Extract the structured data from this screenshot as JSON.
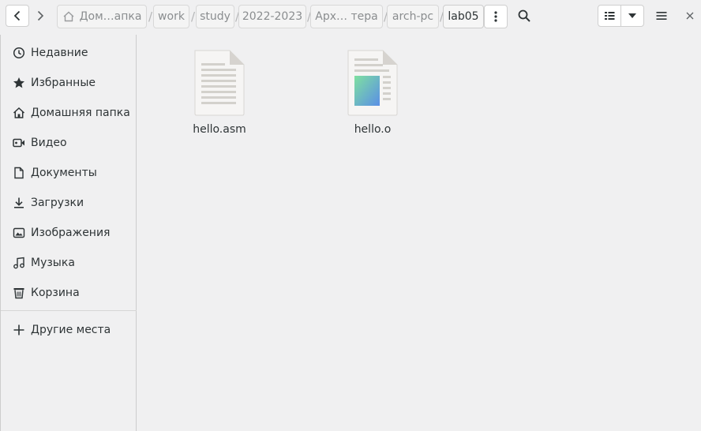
{
  "breadcrumb": [
    {
      "label": "Дом…апка",
      "icon": "home-icon"
    },
    {
      "label": "work"
    },
    {
      "label": "study"
    },
    {
      "label": "2022-2023"
    },
    {
      "label": "Арх… тера"
    },
    {
      "label": "arch-pc"
    },
    {
      "label": "lab05",
      "current": true
    }
  ],
  "breadcrumb_separator": "/",
  "sidebar": {
    "items": [
      {
        "label": "Недавние",
        "icon": "clock-icon"
      },
      {
        "label": "Избранные",
        "icon": "star-icon"
      },
      {
        "label": "Домашняя папка",
        "icon": "home-icon"
      },
      {
        "label": "Видео",
        "icon": "video-icon"
      },
      {
        "label": "Документы",
        "icon": "document-icon"
      },
      {
        "label": "Загрузки",
        "icon": "download-icon"
      },
      {
        "label": "Изображения",
        "icon": "image-icon"
      },
      {
        "label": "Музыка",
        "icon": "music-icon"
      },
      {
        "label": "Корзина",
        "icon": "trash-icon"
      }
    ],
    "other_places": {
      "label": "Другие места",
      "icon": "plus-icon"
    }
  },
  "files": [
    {
      "name": "hello.asm",
      "icon": "text-file-icon"
    },
    {
      "name": "hello.o",
      "icon": "object-file-icon"
    }
  ],
  "colors": {
    "background": "#f0f0f1",
    "text": "#2e3436",
    "crumb_text": "#8a8d8f"
  }
}
